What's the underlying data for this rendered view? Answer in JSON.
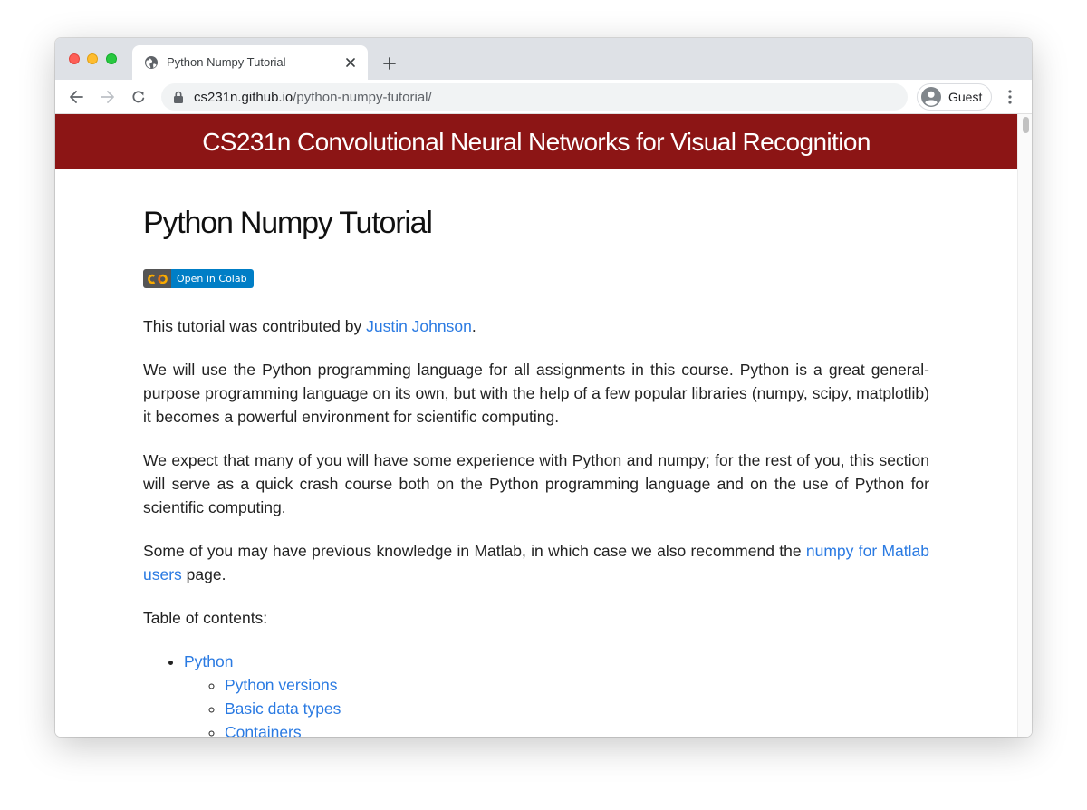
{
  "browser": {
    "tab": {
      "title": "Python Numpy Tutorial"
    },
    "address_bar": {
      "domain": "cs231n.github.io",
      "path": "/python-numpy-tutorial/"
    },
    "profile": {
      "name": "Guest"
    }
  },
  "site": {
    "header_title": "CS231n Convolutional Neural Networks for Visual Recognition"
  },
  "page": {
    "title": "Python Numpy Tutorial",
    "colab_badge": {
      "label": "Open in Colab"
    },
    "intro": {
      "prefix": "This tutorial was contributed by ",
      "author_link": "Justin Johnson",
      "suffix": "."
    },
    "paragraph_2": "We will use the Python programming language for all assignments in this course. Python is a great general-purpose programming language on its own, but with the help of a few popular libraries (numpy, scipy, matplotlib) it becomes a powerful environment for scientific computing.",
    "paragraph_3": "We expect that many of you will have some experience with Python and numpy; for the rest of you, this section will serve as a quick crash course both on the Python programming language and on the use of Python for scientific computing.",
    "paragraph_4": {
      "prefix": "Some of you may have previous knowledge in Matlab, in which case we also recommend the ",
      "link": "numpy for Matlab users",
      "suffix": " page."
    },
    "toc_heading": "Table of contents:",
    "toc": {
      "python": "Python",
      "python_children": [
        "Python versions",
        "Basic data types",
        "Containers"
      ]
    }
  },
  "colors": {
    "header_bg": "#8c1515",
    "link": "#2a7ae2",
    "badge_blue": "#007ec6",
    "badge_gray": "#555555"
  },
  "icons": [
    "globe-icon",
    "close-icon",
    "plus-icon",
    "back-arrow-icon",
    "forward-arrow-icon",
    "reload-icon",
    "lock-icon",
    "account-icon",
    "more-vert-icon",
    "colab-logo-icon"
  ]
}
